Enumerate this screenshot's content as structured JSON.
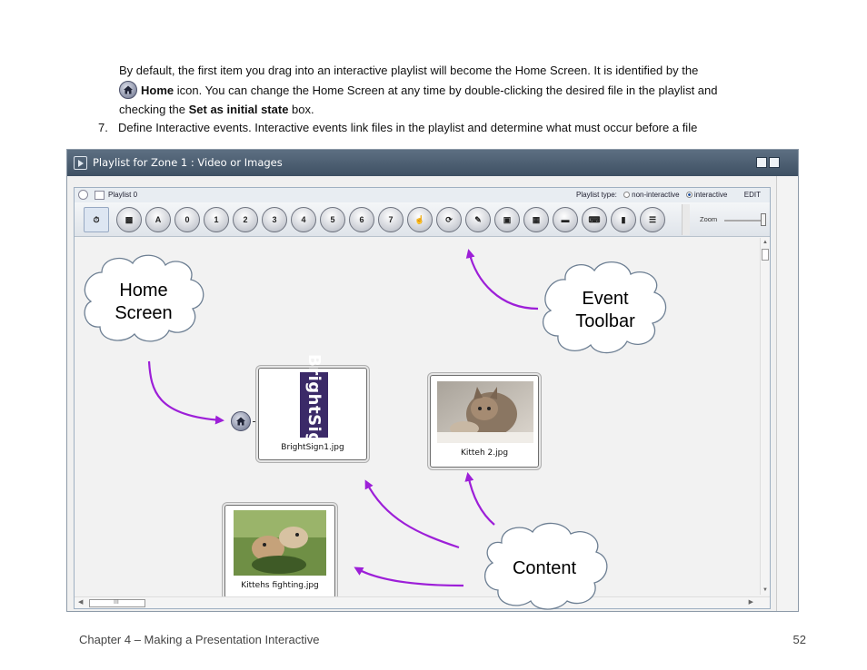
{
  "intro": {
    "line1": "By default, the first item you drag into an interactive playlist will become the Home Screen. It is identified by the",
    "line2_bold": "Home",
    "line2_rest": " icon. You can change the Home Screen at any time by double-clicking the desired file in the playlist and",
    "line3_pre": "checking the ",
    "line3_bold": "Set as initial state",
    "line3_post": " box."
  },
  "step": {
    "number": "7.",
    "text": "Define Interactive events. Interactive events link files in the playlist and determine what must occur before a file"
  },
  "screenshot": {
    "window_title": "Playlist for Zone 1 : Video or Images",
    "playlist_name": "Playlist 0",
    "playlist_type_label": "Playlist type:",
    "option_non_interactive": "non-interactive",
    "option_interactive": "interactive",
    "edit_label": "EDIT",
    "zoom_label": "Zoom",
    "toolbar_digits": [
      "0",
      "1",
      "2",
      "3",
      "4",
      "5",
      "6",
      "7"
    ],
    "files": [
      {
        "caption": "BrightSign1.jpg",
        "logo_text": "BrightSign"
      },
      {
        "caption": "Kitteh 2.jpg"
      },
      {
        "caption": "Kittehs fighting.jpg"
      }
    ],
    "hscroll_mark": "III"
  },
  "callouts": {
    "home_line1": "Home",
    "home_line2": "Screen",
    "event_line1": "Event",
    "event_line2": "Toolbar",
    "content": "Content"
  },
  "colors": {
    "arrow": "#9d1fd8",
    "titlebar": "#4a5c70",
    "logo_bg": "#3b2a68"
  },
  "footer": {
    "chapter": "Chapter 4 – Making a Presentation Interactive",
    "page": "52"
  }
}
